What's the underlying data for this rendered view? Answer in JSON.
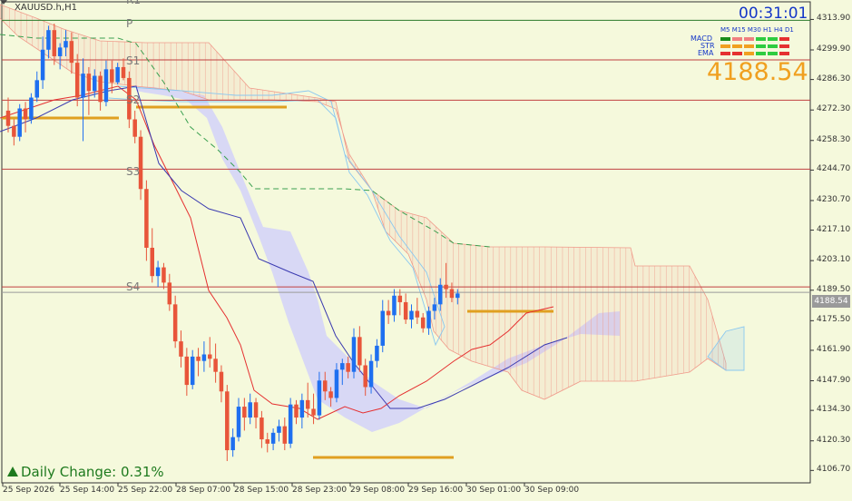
{
  "header": {
    "symbol": "XAUUSD.h,H1",
    "clock": "00:31:01",
    "big_price": "4188.54"
  },
  "indicator_panel": {
    "timeframes": "M5 M15 M30 H1 H4 D1",
    "rows": [
      {
        "name": "MACD",
        "colors": [
          "#1a8c1a",
          "#f08080",
          "#f08080",
          "#2ecc40",
          "#2ecc40",
          "#e53030"
        ]
      },
      {
        "name": "STR",
        "colors": [
          "#f0a020",
          "#f0a020",
          "#f0a020",
          "#2ecc40",
          "#2ecc40",
          "#e53030"
        ]
      },
      {
        "name": "EMA",
        "colors": [
          "#e53030",
          "#e53030",
          "#f0a020",
          "#2ecc40",
          "#2ecc40",
          "#e53030"
        ]
      }
    ]
  },
  "daily_change": "Daily Change: 0.31%",
  "last_price_label": "4188.54",
  "pivots": [
    {
      "name": "R1",
      "value": 4323
    },
    {
      "name": "P",
      "value": 4312
    },
    {
      "name": "S1",
      "value": 4295
    },
    {
      "name": "S2",
      "value": 4277
    },
    {
      "name": "S3",
      "value": 4244
    },
    {
      "name": "S4",
      "value": 4191
    }
  ],
  "colors": {
    "bull": "#1e6ff0",
    "bear": "#e8553a",
    "bg": "#f5f9dc",
    "cloud_purple": "#d8d8f5",
    "kumo_red": "#f09a8a",
    "kumo_blue": "#8ac8f0",
    "tenkan": "#e53030",
    "kijun": "#3a3ab0",
    "chikou": "#3aa050",
    "level_gold": "#e0a020"
  },
  "chart_data": {
    "type": "candlestick",
    "title": "XAUUSD.h,H1",
    "ylim": [
      4101,
      4322
    ],
    "yticks": [
      "4313.90",
      "4299.90",
      "4286.30",
      "4272.30",
      "4258.30",
      "4244.70",
      "4230.70",
      "4217.10",
      "4203.10",
      "4189.50",
      "4175.50",
      "4161.90",
      "4147.90",
      "4134.30",
      "4120.30",
      "4106.70"
    ],
    "xlabels": [
      "25 Sep 2026",
      "25 Sep 14:00",
      "25 Sep 22:00",
      "28 Sep 07:00",
      "28 Sep 15:00",
      "28 Sep 23:00",
      "29 Sep 08:00",
      "29 Sep 16:00",
      "30 Sep 01:00",
      "30 Sep 09:00"
    ],
    "hlines": [
      {
        "value": 4313.5,
        "color": "#2a7a2a"
      },
      {
        "value": 4295.3,
        "color": "#c04040"
      },
      {
        "value": 4276.8,
        "color": "#c04040"
      },
      {
        "value": 4245.1,
        "color": "#c04040"
      },
      {
        "value": 4191.0,
        "color": "#c04040"
      },
      {
        "value": 4188.5,
        "color": "#9a9a9a"
      }
    ],
    "candles": [
      [
        4272,
        4278,
        4262,
        4265
      ],
      [
        4265,
        4268,
        4256,
        4260
      ],
      [
        4260,
        4275,
        4258,
        4273
      ],
      [
        4273,
        4276,
        4262,
        4268
      ],
      [
        4268,
        4280,
        4266,
        4278
      ],
      [
        4278,
        4290,
        4276,
        4286
      ],
      [
        4286,
        4306,
        4282,
        4300
      ],
      [
        4300,
        4311,
        4296,
        4309
      ],
      [
        4309,
        4312,
        4293,
        4297
      ],
      [
        4297,
        4303,
        4291,
        4301
      ],
      [
        4301,
        4309,
        4297,
        4304
      ],
      [
        4304,
        4308,
        4289,
        4294
      ],
      [
        4294,
        4298,
        4274,
        4278
      ],
      [
        4278,
        4296,
        4258,
        4289
      ],
      [
        4289,
        4292,
        4270,
        4281
      ],
      [
        4281,
        4291,
        4278,
        4288
      ],
      [
        4288,
        4290,
        4272,
        4276
      ],
      [
        4276,
        4295,
        4274,
        4291
      ],
      [
        4291,
        4295,
        4280,
        4285
      ],
      [
        4285,
        4294,
        4284,
        4292
      ],
      [
        4292,
        4296,
        4286,
        4287
      ],
      [
        4287,
        4290,
        4264,
        4268
      ],
      [
        4268,
        4272,
        4257,
        4260
      ],
      [
        4260,
        4263,
        4231,
        4236
      ],
      [
        4236,
        4240,
        4203,
        4209
      ],
      [
        4209,
        4218,
        4193,
        4196
      ],
      [
        4196,
        4203,
        4191,
        4200
      ],
      [
        4200,
        4202,
        4190,
        4193
      ],
      [
        4193,
        4197,
        4180,
        4183
      ],
      [
        4183,
        4187,
        4163,
        4166
      ],
      [
        4166,
        4171,
        4154,
        4159
      ],
      [
        4159,
        4163,
        4141,
        4146
      ],
      [
        4146,
        4162,
        4144,
        4159
      ],
      [
        4159,
        4163,
        4150,
        4157
      ],
      [
        4157,
        4166,
        4152,
        4160
      ],
      [
        4160,
        4168,
        4154,
        4158
      ],
      [
        4158,
        4165,
        4147,
        4152
      ],
      [
        4152,
        4155,
        4138,
        4143
      ],
      [
        4143,
        4146,
        4111,
        4116
      ],
      [
        4116,
        4126,
        4113,
        4122
      ],
      [
        4122,
        4140,
        4120,
        4136
      ],
      [
        4136,
        4140,
        4125,
        4131
      ],
      [
        4131,
        4142,
        4128,
        4138
      ],
      [
        4138,
        4140,
        4126,
        4131
      ],
      [
        4131,
        4134,
        4117,
        4121
      ],
      [
        4121,
        4124,
        4115,
        4119
      ],
      [
        4119,
        4126,
        4116,
        4124
      ],
      [
        4124,
        4130,
        4120,
        4127
      ],
      [
        4127,
        4131,
        4116,
        4119
      ],
      [
        4119,
        4140,
        4117,
        4137
      ],
      [
        4137,
        4139,
        4128,
        4131
      ],
      [
        4131,
        4142,
        4126,
        4139
      ],
      [
        4139,
        4147,
        4131,
        4135
      ],
      [
        4135,
        4142,
        4128,
        4132
      ],
      [
        4132,
        4152,
        4130,
        4148
      ],
      [
        4148,
        4152,
        4139,
        4143
      ],
      [
        4143,
        4145,
        4136,
        4140
      ],
      [
        4140,
        4156,
        4138,
        4153
      ],
      [
        4153,
        4158,
        4146,
        4156
      ],
      [
        4156,
        4159,
        4149,
        4152
      ],
      [
        4152,
        4172,
        4149,
        4168
      ],
      [
        4168,
        4173,
        4152,
        4155
      ],
      [
        4155,
        4158,
        4141,
        4145
      ],
      [
        4145,
        4160,
        4142,
        4157
      ],
      [
        4157,
        4167,
        4154,
        4164
      ],
      [
        4164,
        4185,
        4161,
        4180
      ],
      [
        4180,
        4185,
        4174,
        4178
      ],
      [
        4178,
        4190,
        4175,
        4187
      ],
      [
        4187,
        4190,
        4178,
        4184
      ],
      [
        4184,
        4188,
        4174,
        4176
      ],
      [
        4176,
        4183,
        4172,
        4180
      ],
      [
        4180,
        4186,
        4174,
        4177
      ],
      [
        4177,
        4179,
        4170,
        4172
      ],
      [
        4172,
        4182,
        4169,
        4180
      ],
      [
        4180,
        4186,
        4176,
        4183
      ],
      [
        4183,
        4195,
        4180,
        4192
      ],
      [
        4192,
        4202,
        4186,
        4190
      ],
      [
        4190,
        4193,
        4184,
        4186
      ],
      [
        4186,
        4190,
        4183,
        4188
      ]
    ]
  }
}
